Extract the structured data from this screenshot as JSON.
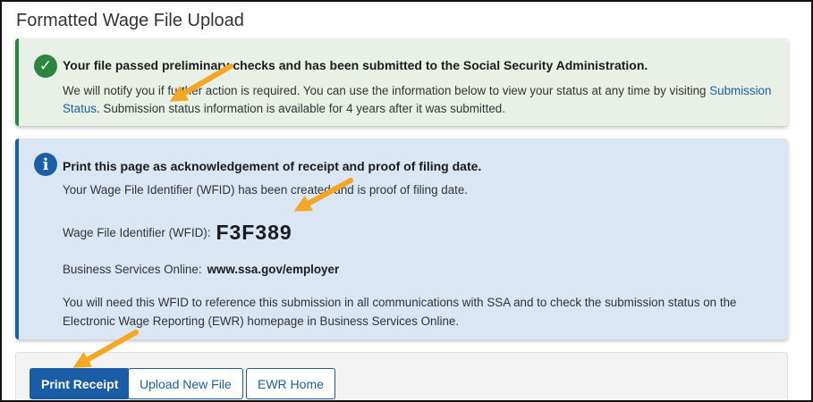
{
  "page": {
    "title": "Formatted Wage File Upload"
  },
  "success_alert": {
    "icon": "check-circle-icon",
    "heading": "Your file passed preliminary checks and has been submitted to the Social Security Administration.",
    "body_before_link": "We will notify you if further action is required. You can use the information below to view your status at any time by visiting ",
    "link_text": "Submission Status",
    "body_after_link": ". Submission status information is available for 4 years after it was submitted.",
    "color": "#2e8540"
  },
  "info_alert": {
    "icon": "info-circle-icon",
    "heading": "Print this page as acknowledgement of receipt and proof of filing date.",
    "wfid_created_text": "Your Wage File Identifier (WFID) has been created and is proof of filing date.",
    "wfid_label": "Wage File Identifier (WFID):",
    "wfid_value": "F3F389",
    "bso_label": "Business Services Online:",
    "bso_url": "www.ssa.gov/employer",
    "note": "You will need this WFID to reference this submission in all communications with SSA and to check the submission status on the Electronic Wage Reporting (EWR) homepage in Business Services Online.",
    "color": "#1b5fa8"
  },
  "actions": {
    "print_receipt": "Print Receipt",
    "upload_new_file": "Upload New File",
    "ewr_home": "EWR Home",
    "primary_color": "#1a5da6"
  },
  "annotations": {
    "arrow_color": "#f5a623",
    "arrow_count": 4
  }
}
